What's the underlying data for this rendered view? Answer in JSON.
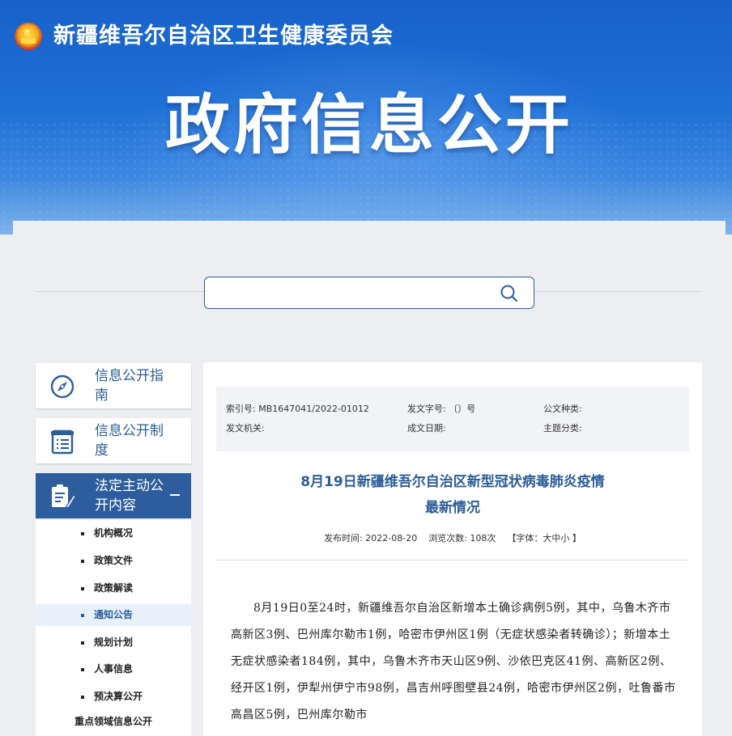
{
  "header": {
    "site_name": "新疆维吾尔自治区卫生健康委员会",
    "hero_title": "政府信息公开"
  },
  "search": {
    "placeholder": ""
  },
  "sidebar": {
    "nav": [
      {
        "label": "信息公开指南",
        "icon": "compass-icon"
      },
      {
        "label": "信息公开制度",
        "icon": "document-list-icon"
      },
      {
        "label": "法定主动公开内容",
        "icon": "document-edit-icon"
      }
    ],
    "sub_items": [
      "机构概况",
      "政策文件",
      "政策解读",
      "通知公告",
      "规划计划",
      "人事信息",
      "预决算公开"
    ],
    "active_sub": "通知公告",
    "sub_heading": "重点领域信息公开"
  },
  "meta": {
    "index_label": "索引号:",
    "index_value": "MB1647041/2022-01012",
    "doc_no_label": "发文字号:",
    "doc_no_value": "〔〕号",
    "doc_type_label": "公文种类:",
    "issuer_label": "发文机关:",
    "date_label": "成文日期:",
    "topic_label": "主题分类:"
  },
  "article": {
    "title_line1": "8月19日新疆维吾尔自治区新型冠状病毒肺炎疫情",
    "title_line2": "最新情况",
    "publish_label": "发布时间:",
    "publish_date": "2022-08-20",
    "views_label": "浏览次数:",
    "views_value": "108次",
    "font_switch": "【字体：大中小 】",
    "body": "8月19日0至24时，新疆维吾尔自治区新增本土确诊病例5例，其中，乌鲁木齐市高新区3例、巴州库尔勒市1例，哈密市伊州区1例（无症状感染者转确诊）；新增本土无症状感染者184例，其中，乌鲁木齐市天山区9例、沙依巴克区41例、高新区2例、经开区1例，伊犁州伊宁市98例，昌吉州呼图壁县24例，哈密市伊州区2例，吐鲁番市高昌区5例，巴州库尔勒市"
  },
  "colors": {
    "brand_blue": "#2d5d9c",
    "banner_blue": "#1e6fd6",
    "title_blue": "#2b5d98"
  }
}
